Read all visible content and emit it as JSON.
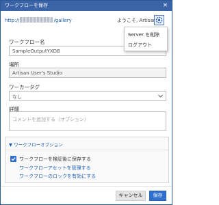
{
  "titlebar": {
    "title": "ワークフローを保存",
    "close_glyph": "×"
  },
  "header": {
    "url_prefix": "http://",
    "url_suffix": "/gallery",
    "welcome": "ようこそ, Artisan",
    "user_icon": "user-gear-icon"
  },
  "user_menu": {
    "items": [
      "Server を削除",
      "ログアウト"
    ]
  },
  "form": {
    "workflow_name_label": "ワークフロー名",
    "workflow_name_value": "SampleOutputYXDB",
    "location_label": "場所",
    "location_value": "Artisan User's Studio",
    "tag_label": "ワーカータグ",
    "tag_value": "なし",
    "details_label": "詳細",
    "details_placeholder": "コメントを追加する（オプション）"
  },
  "options": {
    "header": "▼ ワークフローオプション",
    "validate_checkbox_label": "ワークフローを検証後に保存する",
    "validate_checked": true,
    "link_manage_assets": "ワークフローアセットを管理する",
    "link_lock": "ワークフローのロックを有効にする"
  },
  "buttons": {
    "cancel": "キャンセル",
    "save": "保存"
  },
  "colors": {
    "title_bar": "#3a63a8",
    "accent": "#2f6fd0",
    "link": "#1a5fb4"
  }
}
